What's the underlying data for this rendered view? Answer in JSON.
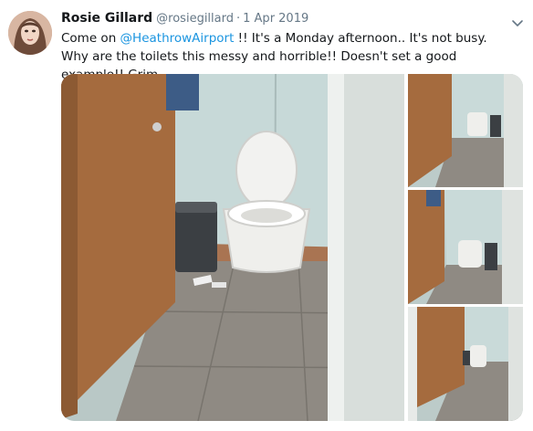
{
  "tweet": {
    "author": {
      "name": "Rosie Gillard",
      "handle": "@rosiegillard",
      "avatar": "profile-photo"
    },
    "separator": "·",
    "date": "1 Apr 2019",
    "text_before": "Come on ",
    "mention": "@HeathrowAirport",
    "text_after": " !! It's a Monday afternoon.. It's not busy. Why are the toilets this messy and horrible!!  Doesn't set a good example!! Grim.",
    "menu_icon": "chevron-down-icon",
    "media": {
      "photo_count": 4,
      "subject": "toilet-stall-photos"
    }
  },
  "colors": {
    "mention": "#1b95e0",
    "secondary_text": "#657786",
    "primary_text": "#14171a",
    "door_wood": "#a0693d",
    "wall": "#c8d8d8",
    "floor": "#9a948c"
  }
}
